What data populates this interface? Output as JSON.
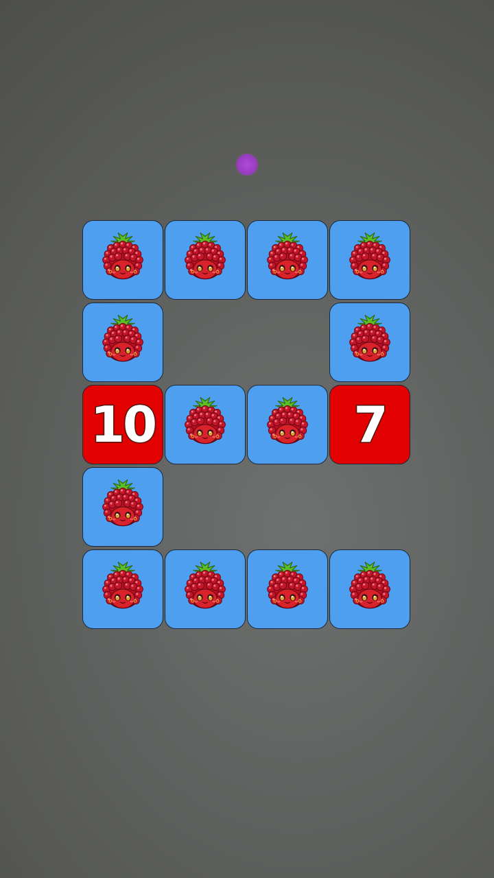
{
  "game": {
    "indicator_color": "#9a3cc4",
    "tile_colors": {
      "fruit": "#4e9ff0",
      "number": "#e30000"
    },
    "fruit_icon": "raspberry-face-icon",
    "grid": {
      "rows": 5,
      "cols": 4,
      "tiles": [
        {
          "row": 0,
          "col": 0,
          "type": "fruit"
        },
        {
          "row": 0,
          "col": 1,
          "type": "fruit"
        },
        {
          "row": 0,
          "col": 2,
          "type": "fruit"
        },
        {
          "row": 0,
          "col": 3,
          "type": "fruit"
        },
        {
          "row": 1,
          "col": 0,
          "type": "fruit"
        },
        {
          "row": 1,
          "col": 3,
          "type": "fruit"
        },
        {
          "row": 2,
          "col": 0,
          "type": "number",
          "value": "10"
        },
        {
          "row": 2,
          "col": 1,
          "type": "fruit"
        },
        {
          "row": 2,
          "col": 2,
          "type": "fruit"
        },
        {
          "row": 2,
          "col": 3,
          "type": "number",
          "value": "7"
        },
        {
          "row": 3,
          "col": 0,
          "type": "fruit"
        },
        {
          "row": 4,
          "col": 0,
          "type": "fruit"
        },
        {
          "row": 4,
          "col": 1,
          "type": "fruit"
        },
        {
          "row": 4,
          "col": 2,
          "type": "fruit"
        },
        {
          "row": 4,
          "col": 3,
          "type": "fruit"
        }
      ]
    }
  }
}
